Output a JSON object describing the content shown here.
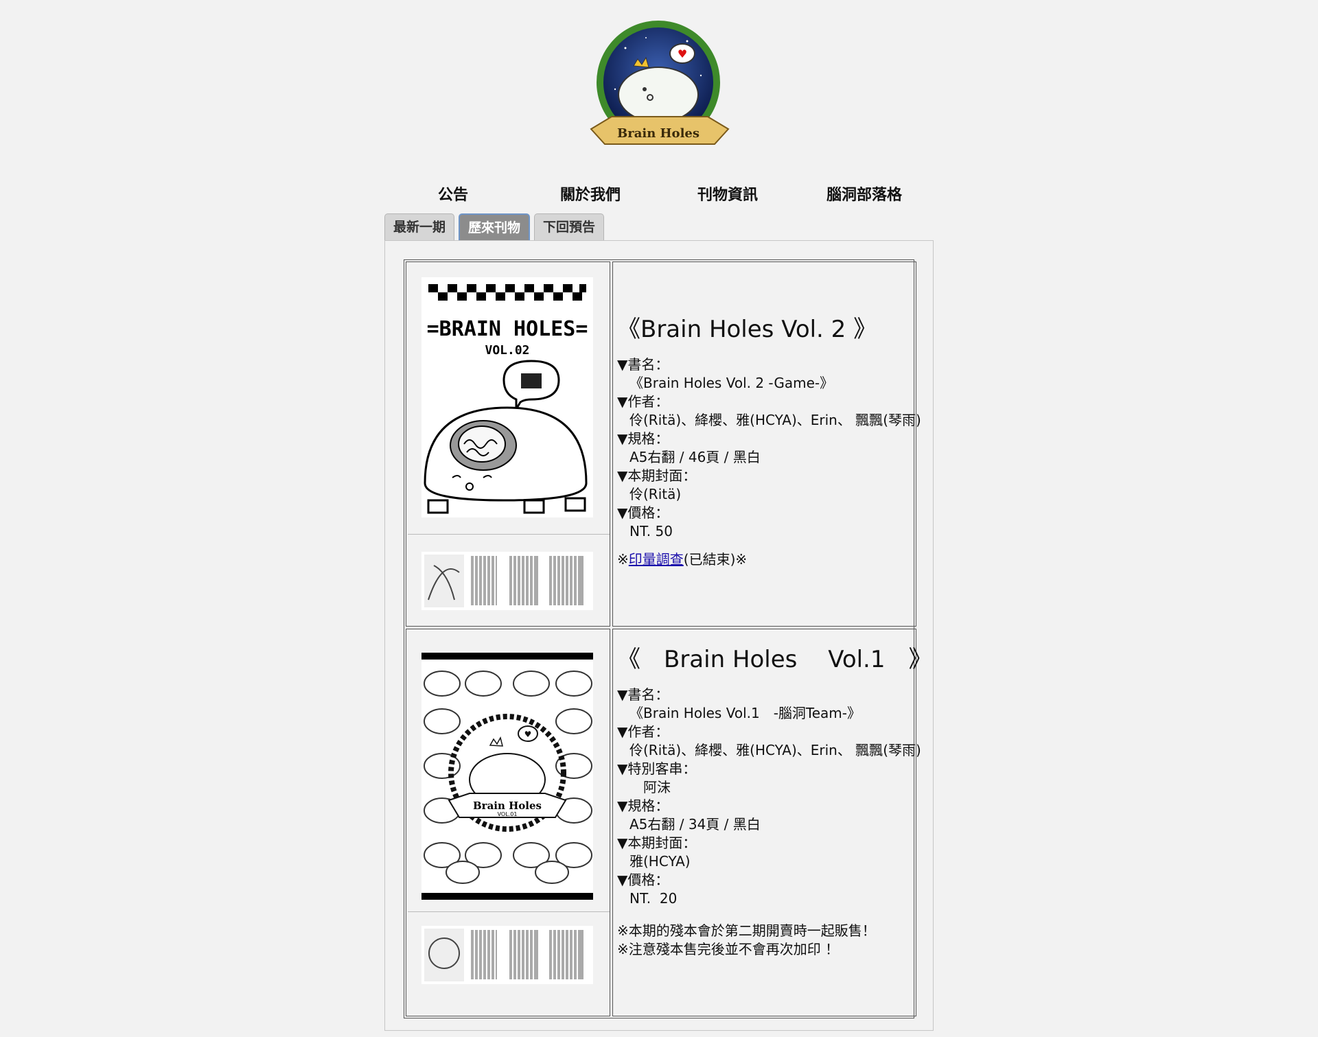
{
  "logo": {
    "text": "Brain Holes"
  },
  "nav": {
    "items": [
      {
        "label": "公告"
      },
      {
        "label": "關於我們"
      },
      {
        "label": "刊物資訊"
      },
      {
        "label": "腦洞部落格"
      }
    ]
  },
  "tabs": [
    {
      "label": "最新一期",
      "active": false
    },
    {
      "label": "歷來刊物",
      "active": true
    },
    {
      "label": "下回預告",
      "active": false
    }
  ],
  "issues": [
    {
      "title": "《Brain Holes Vol. 2 》",
      "cover_text": {
        "line1": "=BRAIN HOLES=",
        "line2": "VOL.02"
      },
      "fields": [
        {
          "label": "▼書名：",
          "value": "《Brain Holes Vol. 2 -Game-》"
        },
        {
          "label": "▼作者：",
          "value": "伶(Ritä)、絳櫻、雅(HCYA)、Erin、 飄飄(琴雨)"
        },
        {
          "label": "▼規格：",
          "value": "A5右翻 / 46頁 / 黑白"
        },
        {
          "label": "▼本期封面：",
          "value": "伶(Ritä)"
        },
        {
          "label": "▼價格：",
          "value": "NT. 50"
        }
      ],
      "note": {
        "prefix": "※",
        "link": "印量調查",
        "suffix": "(已結束)※"
      }
    },
    {
      "title": "《　Brain Holes　 Vol.1　》",
      "cover_text": {
        "line1": "Brain Holes",
        "line2": "VOL.01"
      },
      "fields": [
        {
          "label": "▼書名：",
          "value": "《Brain Holes Vol.1　-腦洞Team-》"
        },
        {
          "label": "▼作者：",
          "value": "伶(Ritä)、絳櫻、雅(HCYA)、Erin、 飄飄(琴雨)"
        },
        {
          "label": "▼特別客串：",
          "value": "　阿沫"
        },
        {
          "label": "▼規格：",
          "value": "A5右翻 / 34頁 / 黑白"
        },
        {
          "label": "▼本期封面：",
          "value": "雅(HCYA)"
        },
        {
          "label": "▼價格：",
          "value": "NT.  20"
        }
      ],
      "notes": [
        "※本期的殘本會於第二期開賣時一起販售！",
        "※注意殘本售完後並不會再次加印 ！"
      ]
    }
  ]
}
